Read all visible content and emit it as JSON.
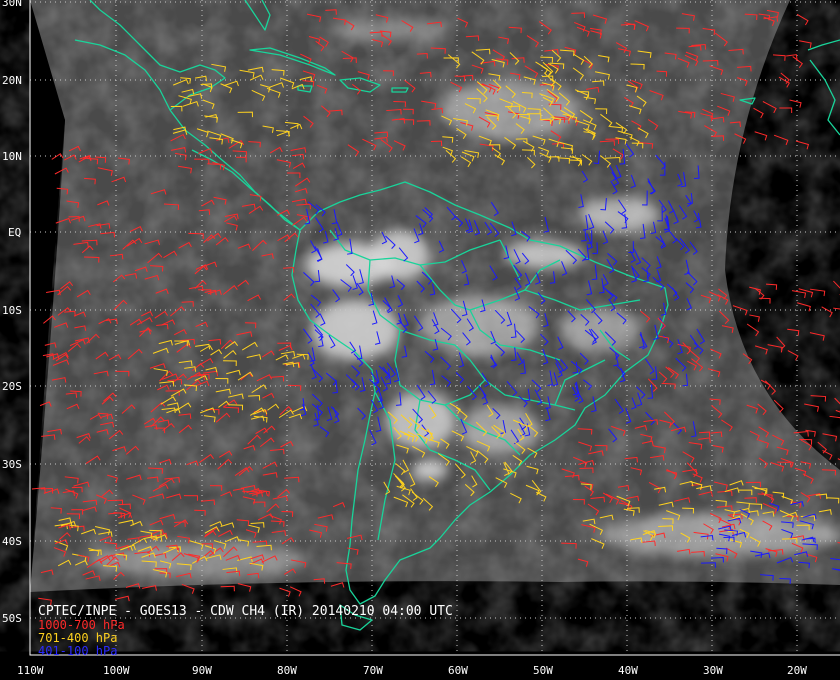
{
  "caption": "CPTEC/INPE - GOES13 - CDW CH4 (IR) 20140210 04:00 UTC",
  "legend": [
    {
      "label": "1000-700 hPa",
      "color": "#ff2a2a"
    },
    {
      "label": "701-400 hPa",
      "color": "#ffd21f"
    },
    {
      "label": "401-100 hPa",
      "color": "#1a1aff"
    }
  ],
  "colors": {
    "coastline": "#19d49a",
    "grid": "#c8c8c8",
    "space": "#000000",
    "ocean": "#4a4a4a"
  },
  "lat_labels": [
    "30N",
    "20N",
    "10N",
    "EQ",
    "10S",
    "20S",
    "30S",
    "40S",
    "50S"
  ],
  "lon_labels": [
    "110W",
    "100W",
    "90W",
    "80W",
    "70W",
    "60W",
    "50W",
    "40W",
    "30W",
    "20W"
  ]
}
